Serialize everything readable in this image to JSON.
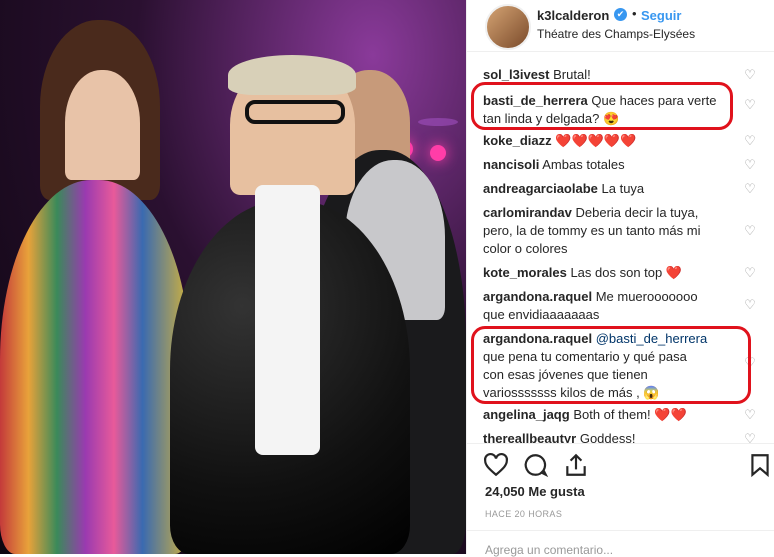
{
  "post": {
    "username": "k3lcalderon",
    "follow_label": "Seguir",
    "separator": "•",
    "location": "Théatre des Champs-Elysées",
    "verified_icon": "✔"
  },
  "comments": [
    {
      "user": "sol_l3ivest",
      "text": "Brutal!"
    },
    {
      "user": "basti_de_herrera",
      "text": "Que haces para verte",
      "text2": "tan linda y delgada? 😍"
    },
    {
      "user": "koke_diazz",
      "text": "❤️❤️❤️❤️❤️"
    },
    {
      "user": "nancisoli",
      "text": "Ambas totales"
    },
    {
      "user": "andreagarciaolabe",
      "text": "La tuya"
    },
    {
      "user": "carlomirandav",
      "text": "Deberia decir la tuya,",
      "text2": "pero, la de tommy es un tanto más mi",
      "text3": "color o colores"
    },
    {
      "user": "kote_morales",
      "text": "Las dos son top ❤️"
    },
    {
      "user": "argandona.raquel",
      "text": "Me muerooooooo",
      "text2": "que envidiaaaaaaas"
    },
    {
      "user": "argandona.raquel",
      "mention": "@basti_de_herrera",
      "text2": "que pena tu comentario y qué pasa",
      "text3": "con esas jóvenes que tienen",
      "text4": "variosssssss kilos de más , 😱"
    },
    {
      "user": "angelina_jaqg",
      "text": "Both of them! ❤️❤️"
    },
    {
      "user": "thereallbeautyr",
      "text": "Goddess!"
    }
  ],
  "icons": {
    "heart": "♡",
    "like": "heart-outline-icon",
    "comment": "comment-bubble-icon",
    "share": "share-arrow-icon",
    "save": "bookmark-icon"
  },
  "likes": "24,050 Me gusta",
  "time": "HACE 20 HORAS",
  "add_comment": "Agrega un comentario...",
  "colors": {
    "highlight": "#e0121c",
    "link": "#3897f0"
  }
}
